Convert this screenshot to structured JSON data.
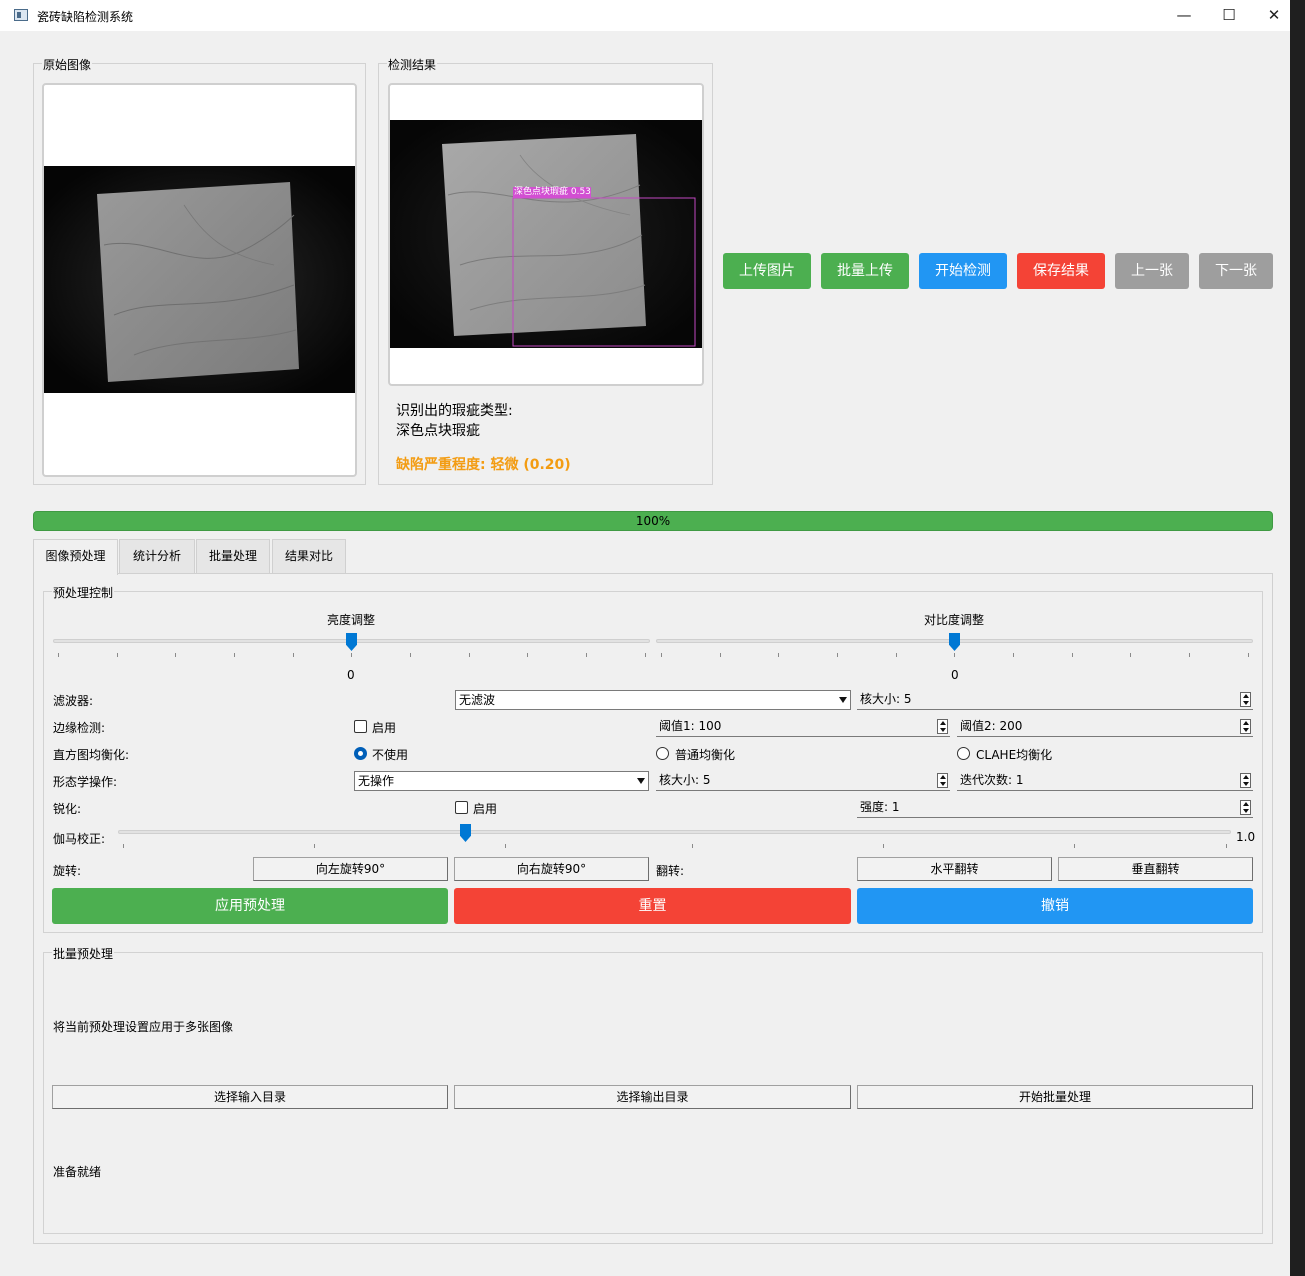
{
  "window": {
    "title": "瓷砖缺陷检测系统",
    "minimize_glyph": "—",
    "maximize_glyph": "☐",
    "close_glyph": "✕"
  },
  "panels": {
    "original": {
      "title": "原始图像"
    },
    "result": {
      "title": "检测结果",
      "detection_label": "深色点块瑕疵 0.53",
      "defect_type_heading": "识别出的瑕疵类型:",
      "defect_type_value": "深色点块瑕疵",
      "severity": "缺陷严重程度: 轻微 (0.20)"
    }
  },
  "actions": [
    {
      "label": "上传图片",
      "color": "#4caf50"
    },
    {
      "label": "批量上传",
      "color": "#4caf50"
    },
    {
      "label": "开始检测",
      "color": "#2196f3"
    },
    {
      "label": "保存结果",
      "color": "#f44336"
    },
    {
      "label": "上一张",
      "color": "#9e9e9e"
    },
    {
      "label": "下一张",
      "color": "#9e9e9e"
    }
  ],
  "progress": {
    "value": 100,
    "text": "100%"
  },
  "tabs": [
    "图像预处理",
    "统计分析",
    "批量处理",
    "结果对比"
  ],
  "preprocess": {
    "group_title": "预处理控制",
    "brightness": {
      "label": "亮度调整",
      "value": "0"
    },
    "contrast": {
      "label": "对比度调整",
      "value": "0"
    },
    "filter": {
      "label": "滤波器:",
      "selected": "无滤波",
      "kernel": "核大小: 5"
    },
    "edge": {
      "label": "边缘检测:",
      "enable": "启用",
      "threshold1": "阈值1: 100",
      "threshold2": "阈值2: 200"
    },
    "histogram": {
      "label": "直方图均衡化:",
      "options": [
        "不使用",
        "普通均衡化",
        "CLAHE均衡化"
      ],
      "selected": "不使用"
    },
    "morph": {
      "label": "形态学操作:",
      "selected": "无操作",
      "kernel": "核大小: 5",
      "iterations": "迭代次数: 1"
    },
    "sharpen": {
      "label": "锐化:",
      "enable": "启用",
      "strength": "强度: 1"
    },
    "gamma": {
      "label": "伽马校正:",
      "value": "1.0"
    },
    "rotate": {
      "label": "旋转:",
      "left": "向左旋转90°",
      "right": "向右旋转90°"
    },
    "flip": {
      "label": "翻转:",
      "horizontal": "水平翻转",
      "vertical": "垂直翻转"
    },
    "apply": "应用预处理",
    "reset": "重置",
    "undo": "撤销",
    "colors": {
      "apply": "#4caf50",
      "reset": "#f44336",
      "undo": "#2196f3"
    }
  },
  "batch": {
    "group_title": "批量预处理",
    "description": "将当前预处理设置应用于多张图像",
    "input_dir": "选择输入目录",
    "output_dir": "选择输出目录",
    "start": "开始批量处理",
    "status": "准备就绪"
  }
}
